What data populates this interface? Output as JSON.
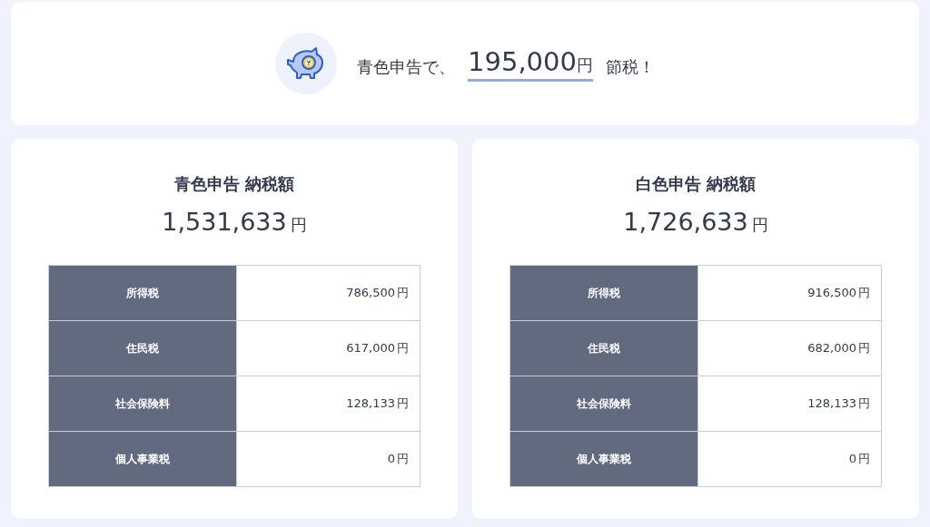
{
  "banner": {
    "lead": "青色申告で、",
    "amount": "195,000",
    "unit": "円",
    "tail": "節税！"
  },
  "cards": [
    {
      "title": "青色申告 納税額",
      "total": "1,531,633",
      "unit": "円",
      "rows": [
        {
          "label": "所得税",
          "value": "786,500",
          "unit": "円"
        },
        {
          "label": "住民税",
          "value": "617,000",
          "unit": "円"
        },
        {
          "label": "社会保険料",
          "value": "128,133",
          "unit": "円"
        },
        {
          "label": "個人事業税",
          "value": "0",
          "unit": "円"
        }
      ]
    },
    {
      "title": "白色申告 納税額",
      "total": "1,726,633",
      "unit": "円",
      "rows": [
        {
          "label": "所得税",
          "value": "916,500",
          "unit": "円"
        },
        {
          "label": "住民税",
          "value": "682,000",
          "unit": "円"
        },
        {
          "label": "社会保険料",
          "value": "128,133",
          "unit": "円"
        },
        {
          "label": "個人事業税",
          "value": "0",
          "unit": "円"
        }
      ]
    }
  ]
}
